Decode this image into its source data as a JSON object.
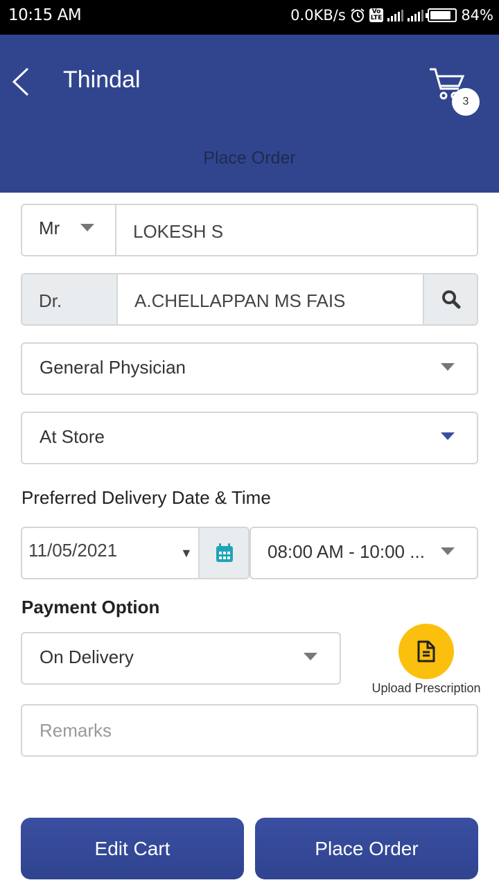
{
  "status_bar": {
    "time": "10:15 AM",
    "network_speed": "0.0KB/s",
    "alarm_icon": "alarm-clock-icon",
    "volte_label": "Vo LTE",
    "network_type": "4G",
    "battery_percent_label": "84%",
    "battery_level": 0.84
  },
  "header": {
    "title": "Thindal",
    "subtitle": "Place Order",
    "cart_count": "3",
    "background_color": "#31458f"
  },
  "form": {
    "salutation": "Mr",
    "patient_name": "LOKESH S",
    "doctor_prefix": "Dr.",
    "doctor_name": "A.CHELLAPPAN MS FAIS",
    "specialty": "General Physician",
    "delivery_mode": "At Store",
    "delivery_section_label": "Preferred Delivery Date & Time",
    "delivery_date": "11/05/2021",
    "delivery_time": "08:00 AM - 10:00 ...",
    "payment_section_label": "Payment Option",
    "payment_option": "On Delivery",
    "upload_prescription_label": "Upload Prescription",
    "remarks_placeholder": "Remarks",
    "remarks_value": ""
  },
  "actions": {
    "edit_cart_label": "Edit Cart",
    "place_order_label": "Place Order"
  },
  "colors": {
    "primary": "#31458f",
    "upload_button": "#fbbf0d",
    "calendar_icon": "#1fa3b8",
    "addon_background": "#e8ecef"
  }
}
